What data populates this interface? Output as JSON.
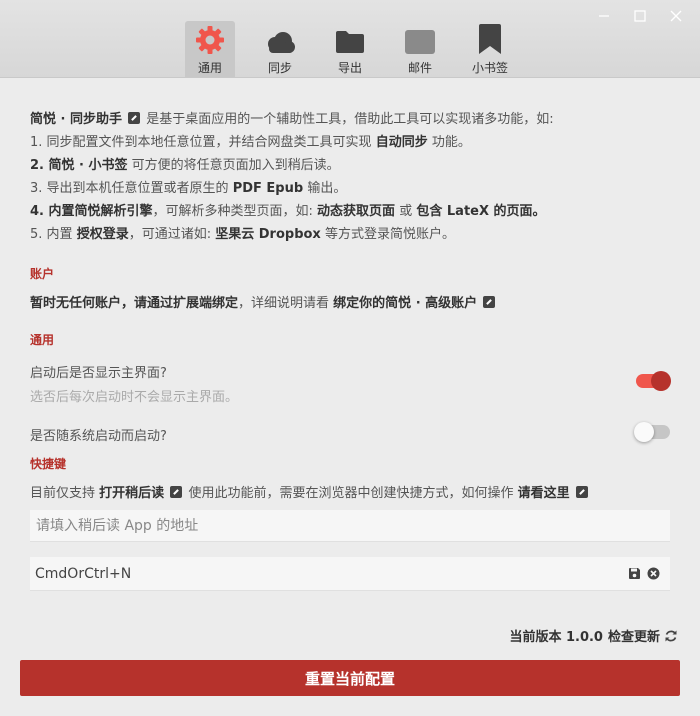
{
  "tabs": [
    {
      "label": "通用",
      "icon": "gear-icon",
      "active": true
    },
    {
      "label": "同步",
      "icon": "cloud-icon",
      "active": false
    },
    {
      "label": "导出",
      "icon": "folder-icon",
      "active": false
    },
    {
      "label": "邮件",
      "icon": "mail-icon",
      "active": false
    },
    {
      "label": "小书签",
      "icon": "bookmark-icon",
      "active": false
    }
  ],
  "intro": {
    "l1_name": "简悦 · 同步助手",
    "l1_text": "是基于桌面应用的一个辅助性工具，借助此工具可以实现诸多功能，如:",
    "l2_a": "1. 同步配置文件到本地任意位置，并结合网盘类工具可实现",
    "l2_b": "自动同步",
    "l2_c": "功能。",
    "l3_a": "2. 简悦 · 小书签",
    "l3_b": "可方便的将任意页面加入到稍后读。",
    "l4_a": "3. 导出到本机任意位置或者原生的",
    "l4_b": "PDF Epub",
    "l4_c": "输出。",
    "l5_a": "4. 内置简悦解析引擎",
    "l5_b": "，可解析多种类型页面，如:",
    "l5_c": "动态获取页面",
    "l5_d": "或",
    "l5_e": "包含 LateX 的页面",
    "l5_f": "。",
    "l6_a": "5. 内置",
    "l6_b": "授权登录",
    "l6_c": "，可通过诸如:",
    "l6_d": "坚果云 Dropbox",
    "l6_e": "等方式登录简悦账户。"
  },
  "account": {
    "title": "账户",
    "text_bold": "暂时无任何账户，请通过扩展端绑定",
    "text_plain": "，详细说明请看",
    "link": "绑定你的简悦 · 高级账户"
  },
  "general": {
    "title": "通用",
    "opt1_label": "启动后是否显示主界面?",
    "opt1_sub": "选否后每次启动时不会显示主界面。",
    "opt1_on": true,
    "opt2_label": "是否随系统启动而启动?",
    "opt2_on": false
  },
  "shortcut": {
    "title": "快捷键",
    "desc_a": "目前仅支持",
    "desc_b": "打开稍后读",
    "desc_c": "使用此功能前，需要在浏览器中创建快捷方式，如何操作",
    "desc_d": "请看这里",
    "url_placeholder": "请填入稍后读 App 的地址",
    "key_value": "CmdOrCtrl+N"
  },
  "footer": {
    "version_label": "当前版本 1.0.0",
    "check_update": "检查更新",
    "reset_button": "重置当前配置"
  },
  "colors": {
    "accent": "#b6322c",
    "toggle_on": "#f0564c",
    "icon_gray": "#444444"
  }
}
